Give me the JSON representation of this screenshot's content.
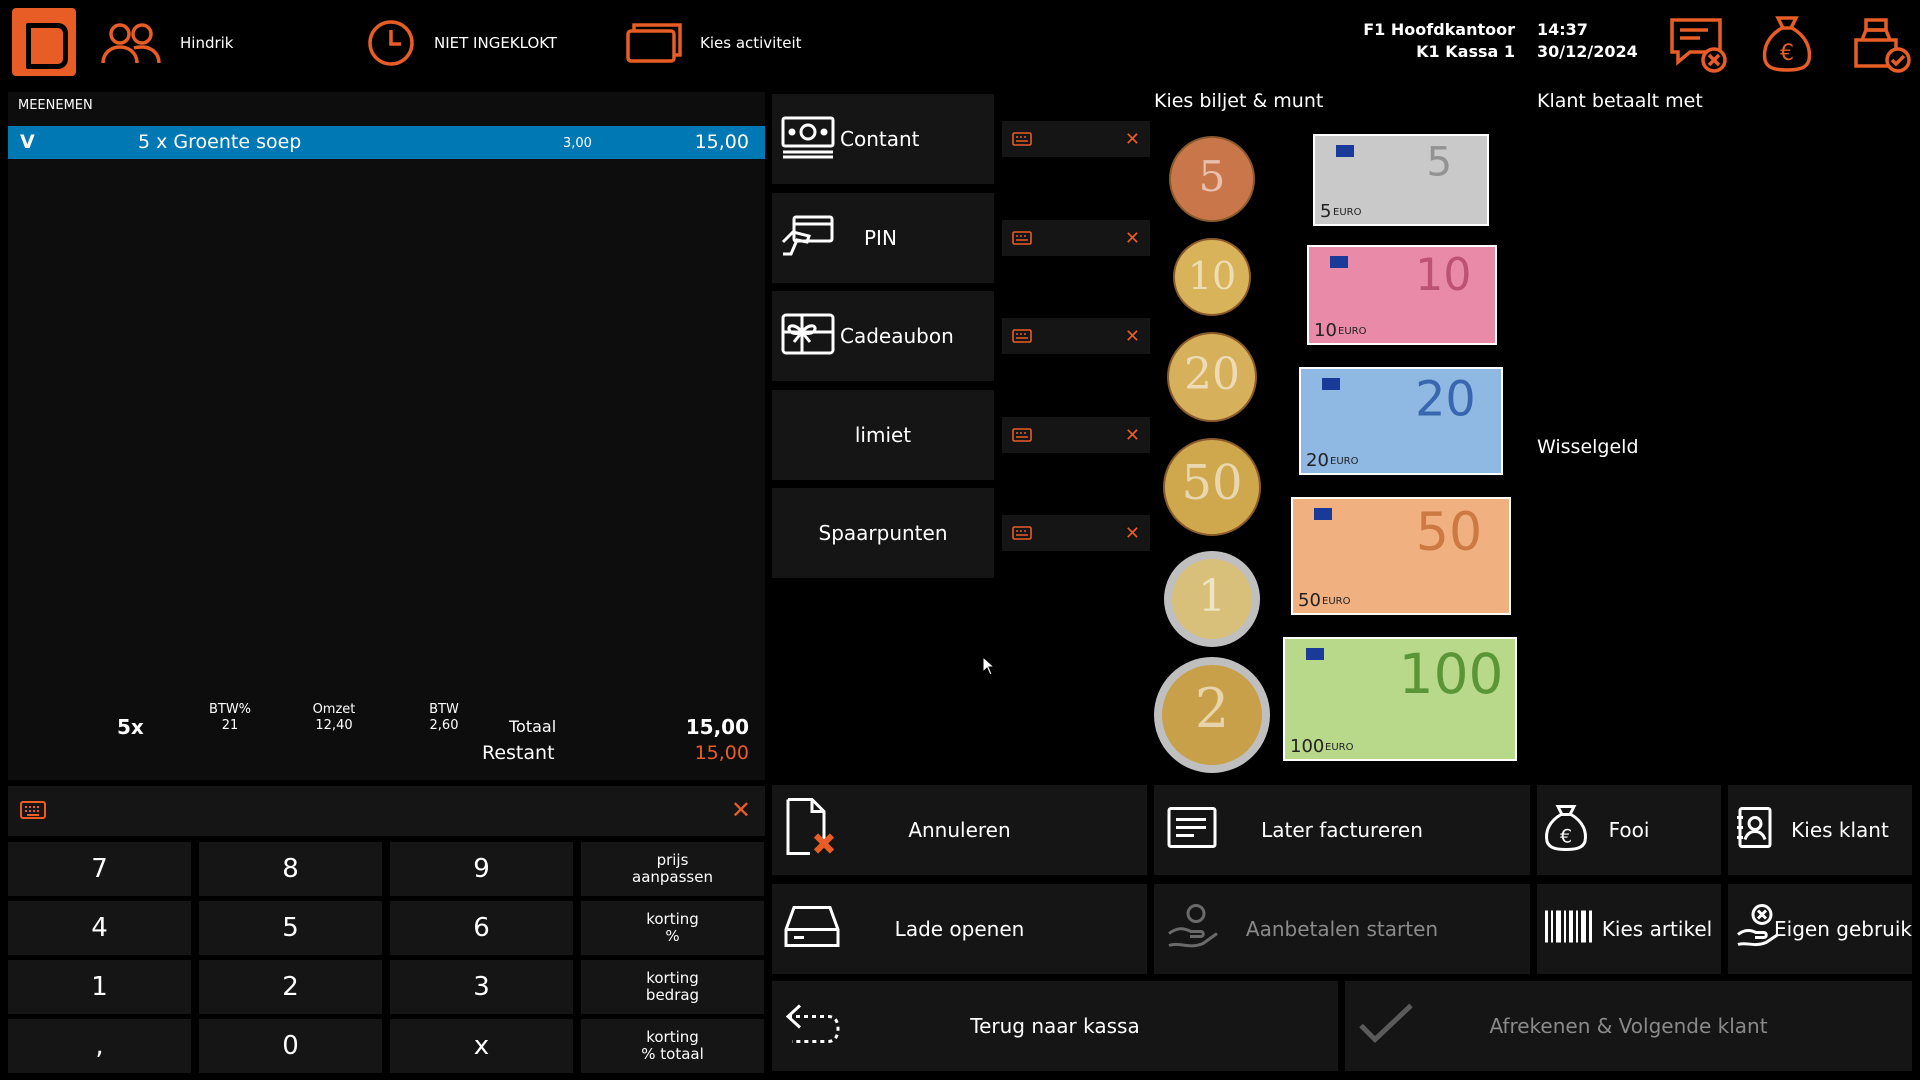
{
  "topbar": {
    "user": "Hindrik",
    "clock_status": "NIET INGEKLOKT",
    "activity": "Kies activiteit",
    "store_line1": "F1 Hoofdkantoor",
    "store_line2": "K1 Kassa 1",
    "time": "14:37",
    "date": "30/12/2024"
  },
  "order": {
    "header": "MEENEMEN",
    "row": {
      "flag": "V",
      "description": "5 x Groente soep",
      "unit_price": "3,00",
      "total": "15,00"
    },
    "summary": {
      "count": "5x",
      "btw_pct_label": "BTW%",
      "btw_pct": "21",
      "omzet_label": "Omzet",
      "omzet": "12,40",
      "btw_label": "BTW",
      "btw": "2,60",
      "totaal_label": "Totaal",
      "totaal": "15,00",
      "restant_label": "Restant",
      "restant": "15,00"
    }
  },
  "keypad": {
    "keys": [
      "7",
      "8",
      "9",
      "prijs\naanpassen",
      "4",
      "5",
      "6",
      "korting\n%",
      "1",
      "2",
      "3",
      "korting\nbedrag",
      ",",
      "0",
      "x",
      "korting\n% totaal"
    ]
  },
  "payment_methods": [
    {
      "label": "Contant",
      "icon": "cash-icon"
    },
    {
      "label": "PIN",
      "icon": "card-icon"
    },
    {
      "label": "Cadeaubon",
      "icon": "gift-card-icon"
    },
    {
      "label": "limiet",
      "icon": ""
    },
    {
      "label": "Spaarpunten",
      "icon": ""
    }
  ],
  "money": {
    "title": "Kies biljet & munt",
    "coins": [
      "5",
      "10",
      "20",
      "50",
      "1",
      "2"
    ],
    "notes": [
      "5",
      "10",
      "20",
      "50",
      "100"
    ],
    "note_currency": "EURO"
  },
  "customer": {
    "pays_with": "Klant betaalt met",
    "change": "Wisselgeld"
  },
  "actions": {
    "annuleren": "Annuleren",
    "later_factureren": "Later factureren",
    "fooi": "Fooi",
    "kies_klant": "Kies klant",
    "lade_openen": "Lade openen",
    "aanbetalen": "Aanbetalen starten",
    "kies_artikel": "Kies artikel",
    "eigen_gebruik": "Eigen gebruik",
    "terug": "Terug naar kassa",
    "afrekenen": "Afrekenen & Volgende klant"
  },
  "colors": {
    "accent": "#e85d26",
    "selected_row": "#0078b4",
    "panel": "#151515",
    "restant": "#e85d26"
  }
}
